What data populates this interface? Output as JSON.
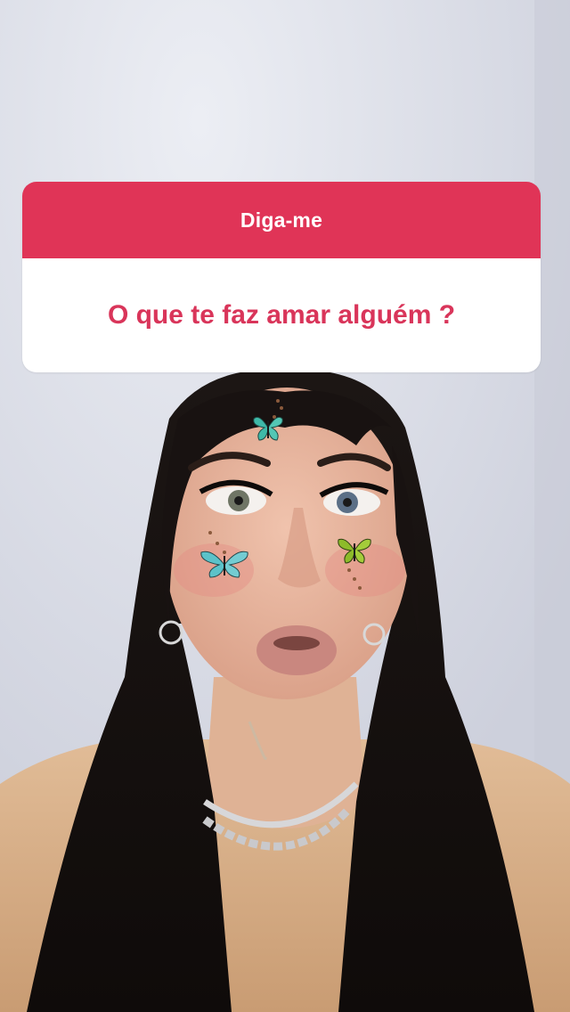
{
  "question_sticker": {
    "header": "Diga-me",
    "question": "O que te faz amar alguém ?"
  },
  "colors": {
    "header_bg": "#e03457",
    "question_text": "#d9355a",
    "wall": "#d6d8e3",
    "hair": "#1a1513",
    "skin": "#e8b9a2",
    "top": "#d9b48f",
    "butterfly_teal": "#3fb9a8",
    "butterfly_green": "#8dbb2a"
  },
  "scene": {
    "photo_subject": "person-with-butterfly-makeup",
    "icons": [
      "butterfly-forehead-icon",
      "butterfly-left-cheek-icon",
      "butterfly-right-cheek-icon"
    ]
  }
}
